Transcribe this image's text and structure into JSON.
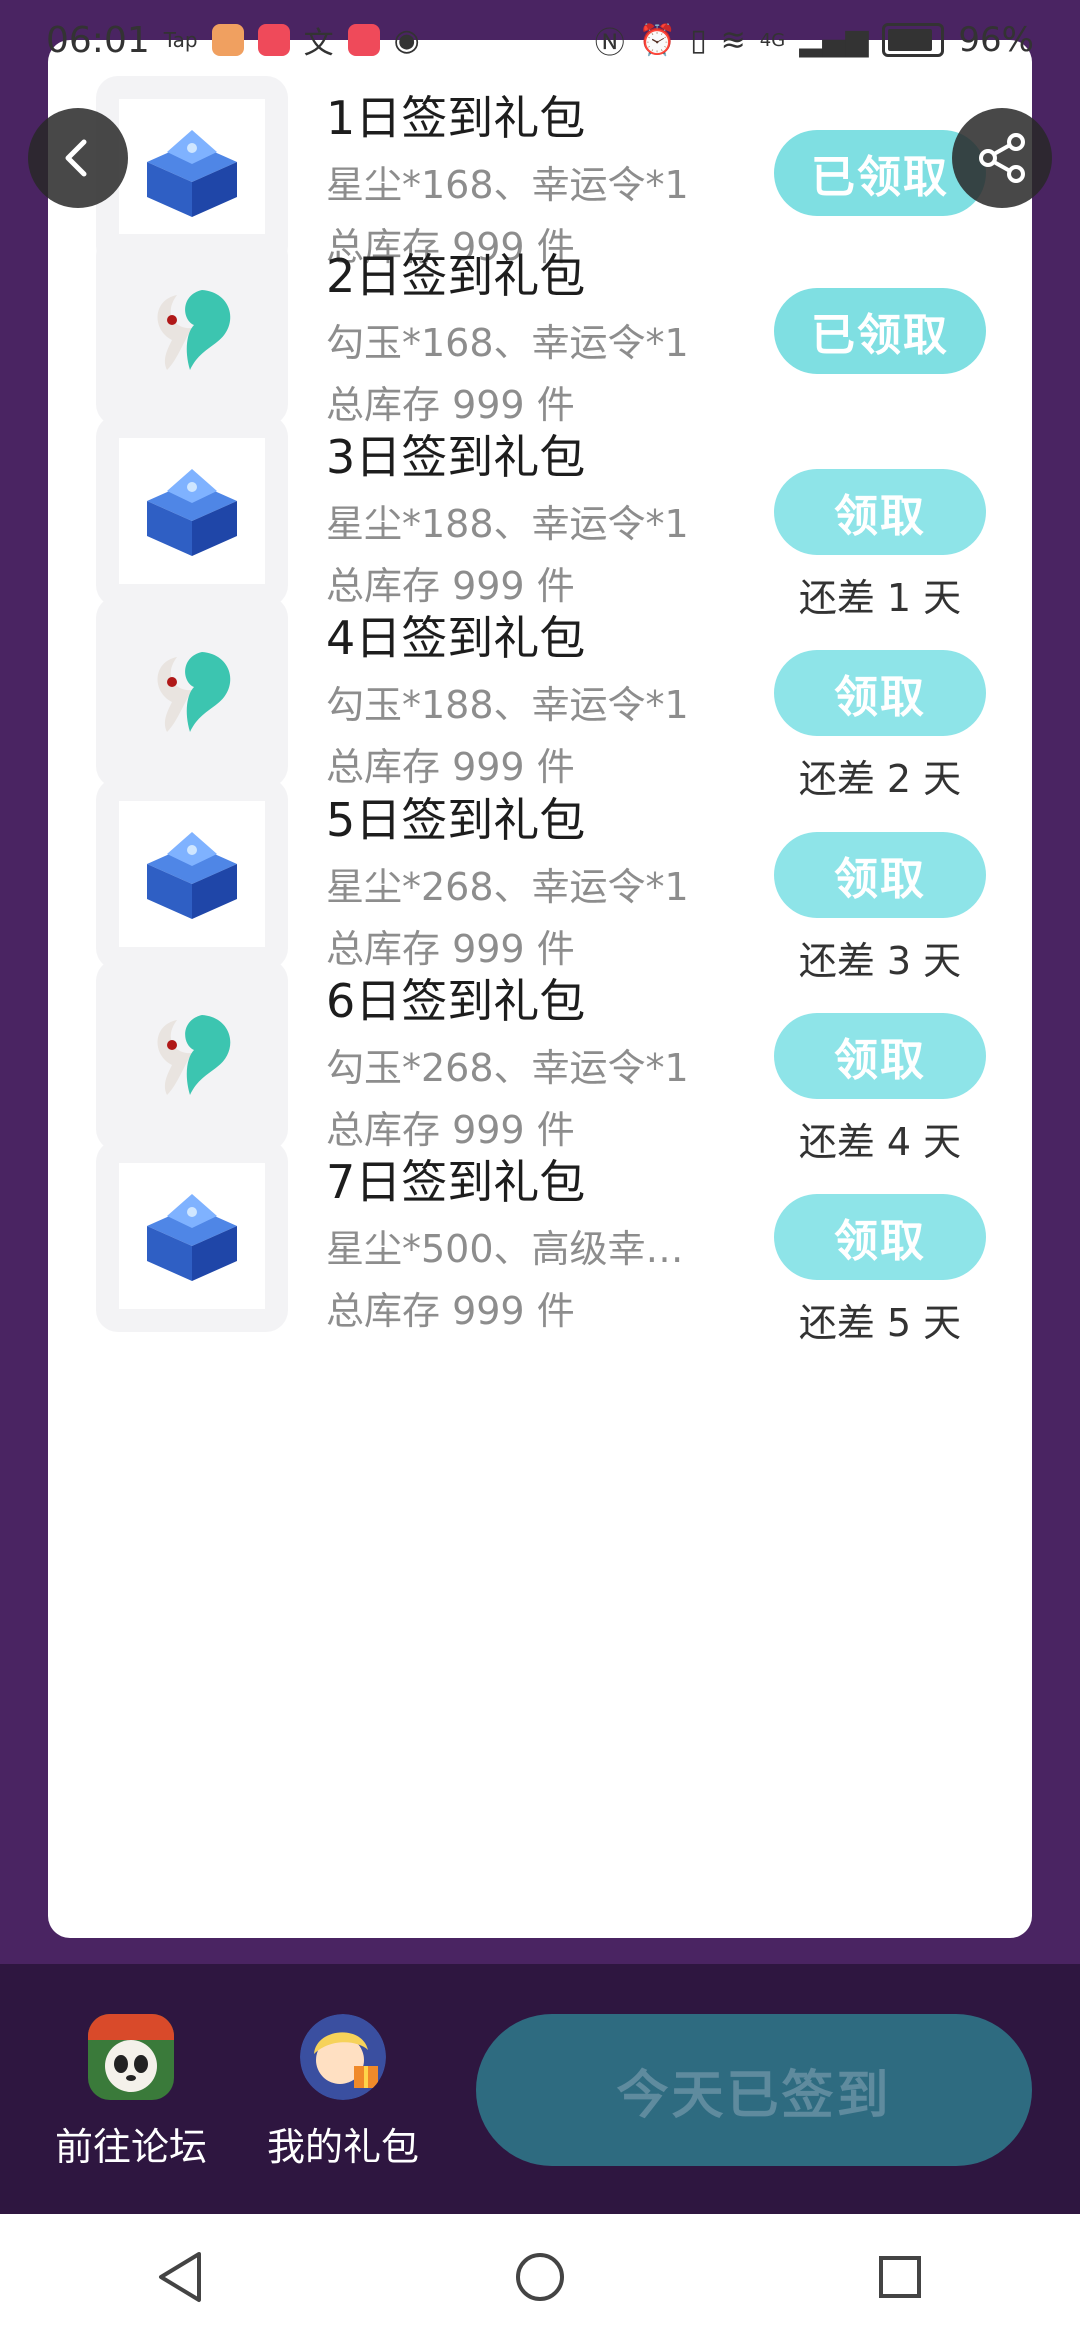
{
  "status_bar": {
    "time": "06:01",
    "tap_label": "Tap",
    "text_icon": "文",
    "battery": "96%",
    "net_label": "4G"
  },
  "gifts": [
    {
      "title": "1日签到礼包",
      "desc": "星尘*168、幸运令*1",
      "stock": "总库存 999 件",
      "icon": "crystal-chest-icon",
      "button": "已领取",
      "remaining": ""
    },
    {
      "title": "2日签到礼包",
      "desc": "勾玉*168、幸运令*1",
      "stock": "总库存 999 件",
      "icon": "magatama-icon",
      "button": "已领取",
      "remaining": ""
    },
    {
      "title": "3日签到礼包",
      "desc": "星尘*188、幸运令*1",
      "stock": "总库存 999 件",
      "icon": "crystal-chest-icon",
      "button": "领取",
      "remaining": "还差 1 天"
    },
    {
      "title": "4日签到礼包",
      "desc": "勾玉*188、幸运令*1",
      "stock": "总库存 999 件",
      "icon": "magatama-icon",
      "button": "领取",
      "remaining": "还差 2 天"
    },
    {
      "title": "5日签到礼包",
      "desc": "星尘*268、幸运令*1",
      "stock": "总库存 999 件",
      "icon": "crystal-chest-icon",
      "button": "领取",
      "remaining": "还差 3 天"
    },
    {
      "title": "6日签到礼包",
      "desc": "勾玉*268、幸运令*1",
      "stock": "总库存 999 件",
      "icon": "magatama-icon",
      "button": "领取",
      "remaining": "还差 4 天"
    },
    {
      "title": "7日签到礼包",
      "desc": "星尘*500、高级幸…",
      "stock": "总库存 999 件",
      "icon": "crystal-chest-icon",
      "button": "领取",
      "remaining": "还差 5 天"
    }
  ],
  "bottom_bar": {
    "forum_label": "前往论坛",
    "gifts_label": "我的礼包",
    "checkin_label": "今天已签到"
  },
  "colors": {
    "background": "#4a2462",
    "button": "#8ee4e8",
    "checkin_button": "#2e6b80",
    "bottom_bar": "#2e1640"
  }
}
